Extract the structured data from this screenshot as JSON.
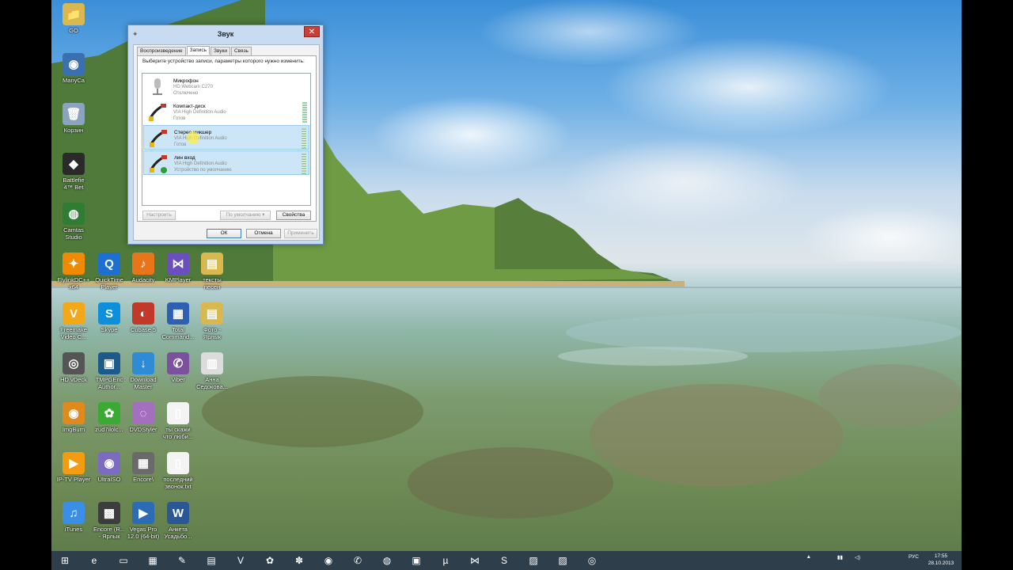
{
  "desktop": {
    "icons": [
      {
        "name": "icon-go",
        "label": "GO",
        "glyph": "📁",
        "color": "#d9b850"
      },
      {
        "name": "icon-manycam",
        "label": "ManyCa",
        "glyph": "◉",
        "color": "#3a6fb0"
      },
      {
        "name": "icon-recycle-bin",
        "label": "Корзин",
        "glyph": "🗑",
        "color": "#8aa4c0"
      },
      {
        "name": "icon-battlefield",
        "label": "Battlefie\n4™ Bet",
        "glyph": "◆",
        "color": "#2a2a2a"
      },
      {
        "name": "icon-camtasia",
        "label": "Camtas\nStudio",
        "glyph": "◍",
        "color": "#2e7d32"
      },
      {
        "name": "icon-flylinkdc",
        "label": "FlylinkDC++\nx64",
        "glyph": "✦",
        "color": "#f08a00"
      },
      {
        "name": "icon-quicktime",
        "label": "QuickTime\nPlayer",
        "glyph": "Q",
        "color": "#1d6fd1"
      },
      {
        "name": "icon-audacity",
        "label": "Audacity",
        "glyph": "♪",
        "color": "#e8751a"
      },
      {
        "name": "icon-kmplayer",
        "label": "KMPlayer",
        "glyph": "⋈",
        "color": "#6b4fbf"
      },
      {
        "name": "icon-lyrics-folder",
        "label": "тексты\nпесен",
        "glyph": "▤",
        "color": "#d9b850"
      },
      {
        "name": "icon-freemake",
        "label": "Freemake\nVideo C...",
        "glyph": "V",
        "color": "#f3a81a"
      },
      {
        "name": "icon-skype",
        "label": "Skype",
        "glyph": "S",
        "color": "#0d8fdc"
      },
      {
        "name": "icon-cubase",
        "label": "Cubase 5",
        "glyph": "◐",
        "color": "#c0392b"
      },
      {
        "name": "icon-total-commander",
        "label": "Total\nCommand...",
        "glyph": "▦",
        "color": "#2f5fb3"
      },
      {
        "name": "icon-photo-shortcut",
        "label": "Фото -\nЯрлык",
        "glyph": "▤",
        "color": "#d9b850"
      },
      {
        "name": "icon-hd-vdeck",
        "label": "HD vDeck",
        "glyph": "◎",
        "color": "#555"
      },
      {
        "name": "icon-tmpgenc",
        "label": "TMPGEnc\nAuthor...",
        "glyph": "▣",
        "color": "#1c5a8c"
      },
      {
        "name": "icon-download-master",
        "label": "Download\nMaster",
        "glyph": "↓",
        "color": "#2f8bd6"
      },
      {
        "name": "icon-viber",
        "label": "Viber",
        "glyph": "✆",
        "color": "#7b519d"
      },
      {
        "name": "icon-anna-wmv",
        "label": "Анна\nСедокова...",
        "glyph": "▥",
        "color": "#dcdcdc"
      },
      {
        "name": "icon-imgburn",
        "label": "ImgBurn",
        "glyph": "◉",
        "color": "#e08a1e"
      },
      {
        "name": "icon-zuD",
        "label": "zud7ilolc...",
        "glyph": "✿",
        "color": "#3aaa35"
      },
      {
        "name": "icon-dvdstyler",
        "label": "DVDStyler",
        "glyph": "◌",
        "color": "#a56fbf"
      },
      {
        "name": "icon-text-file",
        "label": "ты скажи\nчто люби...",
        "glyph": "▯",
        "color": "#f4f4f4"
      },
      {
        "name": "icon-iptv-player",
        "label": "IP-TV Player",
        "glyph": "▶",
        "color": "#f39c12"
      },
      {
        "name": "icon-ultraiso",
        "label": "UltraISO",
        "glyph": "◉",
        "color": "#7b6cc2"
      },
      {
        "name": "icon-encore",
        "label": "Encore\\",
        "glyph": "▦",
        "color": "#6a6a6a"
      },
      {
        "name": "icon-last-call",
        "label": "последний\nзвонок.txt",
        "glyph": "▯",
        "color": "#f4f4f4"
      },
      {
        "name": "icon-itunes",
        "label": "iTunes",
        "glyph": "♫",
        "color": "#3a8ee6"
      },
      {
        "name": "icon-encore-shortcut",
        "label": "Encore (R...\n- Ярлык",
        "glyph": "▩",
        "color": "#3d3d3d"
      },
      {
        "name": "icon-vegas-pro",
        "label": "Vegas Pro\n12.0 (64-bit)",
        "glyph": "▶",
        "color": "#2c6cb5"
      },
      {
        "name": "icon-anketa",
        "label": "Анкета\nУсадьбо...",
        "glyph": "W",
        "color": "#2b5797"
      }
    ]
  },
  "window": {
    "title": "Звук",
    "close_label": "✕",
    "tabs": [
      "Воспроизведение",
      "Запись",
      "Звуки",
      "Связь"
    ],
    "instruction": "Выберите устройство записи, параметры которого нужно изменить:",
    "devices": [
      {
        "name": "Микрофон",
        "sub": "HD Webcam C270",
        "status": "Отключено"
      },
      {
        "name": "Компакт-диск",
        "sub": "VIA High Definition Audio",
        "status": "Готов"
      },
      {
        "name": "Стерео микшер",
        "sub": "VIA High Definition Audio",
        "status": "Готов"
      },
      {
        "name": "лин вход",
        "sub": "VIA High Definition Audio",
        "status": "Устройство по умолчанию"
      }
    ],
    "configure_label": "Настроить",
    "default_label": "По умолчанию",
    "properties_label": "Свойства",
    "ok_label": "ОК",
    "cancel_label": "Отмена",
    "apply_label": "Применить"
  },
  "taskbar": {
    "apps": [
      {
        "name": "start-button",
        "glyph": "⊞"
      },
      {
        "name": "taskbar-ie",
        "glyph": "e"
      },
      {
        "name": "taskbar-explorer",
        "glyph": "▭"
      },
      {
        "name": "taskbar-calculator",
        "glyph": "▦"
      },
      {
        "name": "taskbar-paint",
        "glyph": "✎"
      },
      {
        "name": "taskbar-notepad",
        "glyph": "▤"
      },
      {
        "name": "taskbar-freemake",
        "glyph": "V"
      },
      {
        "name": "taskbar-paw",
        "glyph": "✿"
      },
      {
        "name": "taskbar-green",
        "glyph": "✽"
      },
      {
        "name": "taskbar-chrome",
        "glyph": "◉"
      },
      {
        "name": "taskbar-viber",
        "glyph": "✆"
      },
      {
        "name": "taskbar-firefox",
        "glyph": "◍"
      },
      {
        "name": "taskbar-tmpgenc",
        "glyph": "▣"
      },
      {
        "name": "taskbar-utorrent",
        "glyph": "µ"
      },
      {
        "name": "taskbar-kmplayer",
        "glyph": "⋈"
      },
      {
        "name": "taskbar-skype",
        "glyph": "S"
      },
      {
        "name": "taskbar-app1",
        "glyph": "▨"
      },
      {
        "name": "taskbar-app2",
        "glyph": "▨"
      },
      {
        "name": "taskbar-sound",
        "glyph": "◎"
      }
    ],
    "lang": "РУС",
    "time": "17:55",
    "date": "28.10.2013"
  }
}
